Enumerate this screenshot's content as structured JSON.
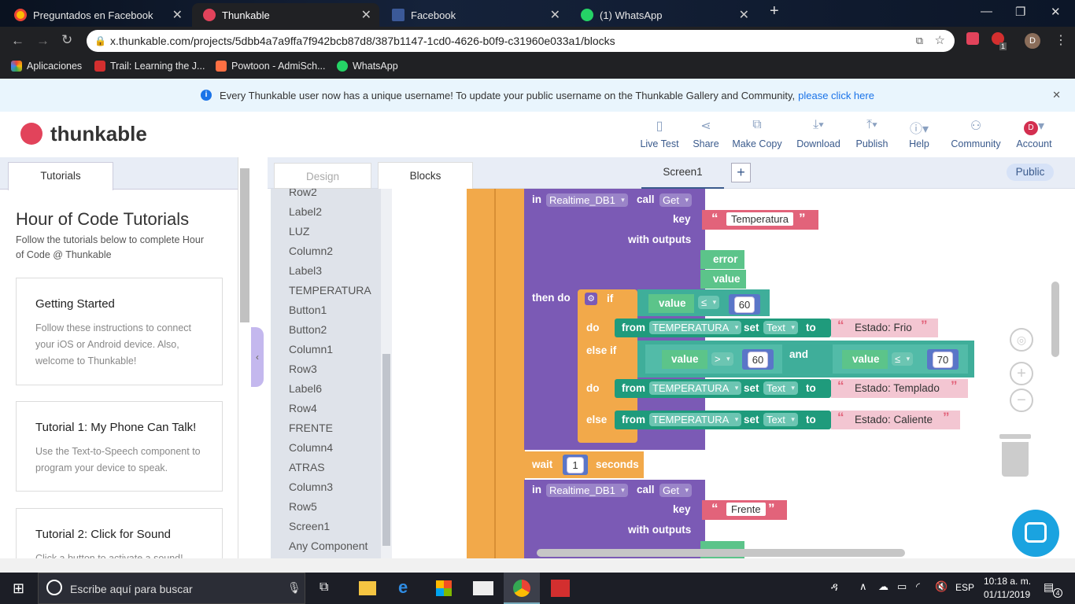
{
  "browser": {
    "tabs": [
      {
        "title": "Preguntados en Facebook",
        "active": false
      },
      {
        "title": "Thunkable",
        "active": true
      },
      {
        "title": "Facebook",
        "active": false
      },
      {
        "title": "(1) WhatsApp",
        "active": false
      }
    ],
    "url": "x.thunkable.com/projects/5dbb4a7a9ffa7f942bcb87d8/387b1147-1cd0-4626-b0f9-c31960e033a1/blocks",
    "bookmarks": [
      "Aplicaciones",
      "Trail: Learning the J...",
      "Powtoon - AdmiSch...",
      "WhatsApp"
    ],
    "profile_initial": "D",
    "ext_badge": "1"
  },
  "banner": {
    "text": "Every Thunkable user now has a unique username! To update your public username on the Thunkable Gallery and Community,",
    "link": "please click here"
  },
  "header": {
    "logo": "thunkable",
    "toolbar": [
      "Live Test",
      "Share",
      "Make Copy",
      "Download",
      "Publish",
      "Help",
      "Community",
      "Account"
    ],
    "account_initial": "D"
  },
  "left": {
    "tab": "Tutorials",
    "title": "Hour of Code Tutorials",
    "subtitle": "Follow the tutorials below to complete Hour of Code @ Thunkable",
    "cards": [
      {
        "title": "Getting Started",
        "desc": "Follow these instructions to connect your iOS or Android device. Also, welcome to Thunkable!"
      },
      {
        "title": "Tutorial 1: My Phone Can Talk!",
        "desc": "Use the Text-to-Speech component to program your device to speak."
      },
      {
        "title": "Tutorial 2: Click for Sound",
        "desc": "Click a button to activate a sound!"
      }
    ]
  },
  "workspace": {
    "tabs": {
      "design": "Design",
      "blocks": "Blocks",
      "screen": "Screen1",
      "add": "+",
      "public": "Public"
    },
    "components": [
      "Row2",
      "Label2",
      "LUZ",
      "Column2",
      "Label3",
      "TEMPERATURA",
      "Button1",
      "Button2",
      "Column1",
      "Row3",
      "Label6",
      "Row4",
      "FRENTE",
      "Column4",
      "ATRAS",
      "Column3",
      "Row5",
      "Screen1",
      "Any Component"
    ]
  },
  "blocks": {
    "in": "in",
    "db": "Realtime_DB1",
    "call": "call",
    "get": "Get",
    "key": "key",
    "with_outputs": "with outputs",
    "key1": "Temperatura",
    "key2": "Frente",
    "error": "error",
    "value": "value",
    "then_do": "then do",
    "if": "if",
    "do": "do",
    "else_if": "else if",
    "else": "else",
    "lte": "≤",
    "gt": ">",
    "and": "and",
    "n60": "60",
    "n70": "70",
    "from": "from",
    "comp": "TEMPERATURA",
    "set": "set",
    "prop": "Text",
    "to": "to",
    "s1": "Estado: Frio",
    "s2": "Estado: Templado",
    "s3": "Estado: Caliente",
    "wait": "wait",
    "n1": "1",
    "seconds": "seconds"
  },
  "taskbar": {
    "search": "Escribe aquí para buscar",
    "lang": "ESP",
    "time": "10:18 a. m.",
    "date": "01/11/2019",
    "notif": "4"
  },
  "colors": {
    "purple": "#7b5ab5",
    "orange": "#f2a94a",
    "teal": "#3fae9a",
    "pink": "#e2637a",
    "accent": "#1a73e8"
  }
}
